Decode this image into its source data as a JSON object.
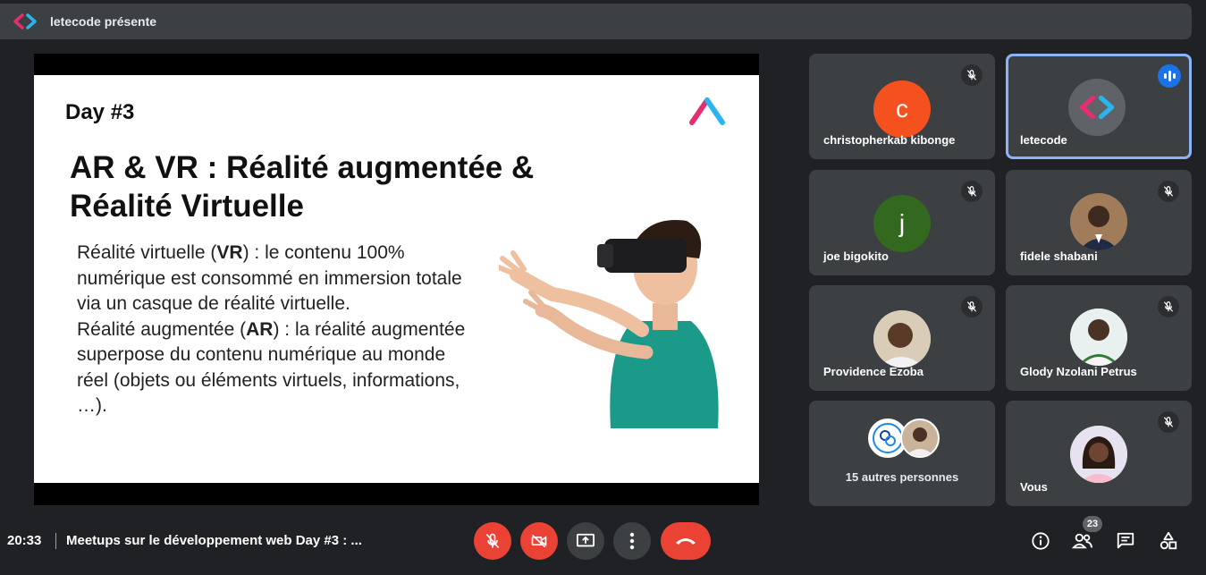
{
  "presenter_bar": {
    "label": "letecode présente",
    "logo_icon": "letecode-logo-icon"
  },
  "slide": {
    "day": "Day #3",
    "title": "AR & VR : Réalité augmentée & Réalité Virtuelle",
    "vr_label": "Réalité virtuelle (",
    "vr_abbr": "VR",
    "vr_text": ") : le contenu 100% numérique est consommé en immersion totale via un casque de réalité virtuelle.",
    "ar_label": "Réalité augmentée (",
    "ar_abbr": "AR",
    "ar_text": ") : la réalité augmentée superpose du contenu numérique au monde réel (objets ou éléments virtuels, informations, …)."
  },
  "participants": [
    {
      "name": "christopherkab kibonge",
      "initial": "c",
      "avatar_color": "#f4511e",
      "muted": true
    },
    {
      "name": "letecode",
      "initial": "",
      "avatar_color": "#5f6368",
      "muted": false,
      "speaking": true
    },
    {
      "name": "joe bigokito",
      "initial": "j",
      "avatar_color": "#33691e",
      "muted": true
    },
    {
      "name": "fidele shabani",
      "initial": "",
      "avatar_color": "#8d6e63",
      "muted": true
    },
    {
      "name": "Providence Ezoba",
      "initial": "",
      "avatar_color": "#c8b8a0",
      "muted": true
    },
    {
      "name": "Glody Nzolani Petrus",
      "initial": "",
      "avatar_color": "#d7e6e6",
      "muted": true
    },
    {
      "name": "Vous",
      "initial": "",
      "avatar_color": "#d6cfe0",
      "muted": true
    }
  ],
  "others": {
    "label": "15 autres personnes"
  },
  "bottom": {
    "time": "20:33",
    "meeting_title": "Meetups sur le développement web Day #3 : ...",
    "people_count": "23"
  },
  "colors": {
    "accent": "#8ab4f8",
    "danger": "#ea4335",
    "tile_bg": "#3c4043",
    "page_bg": "#202124"
  }
}
